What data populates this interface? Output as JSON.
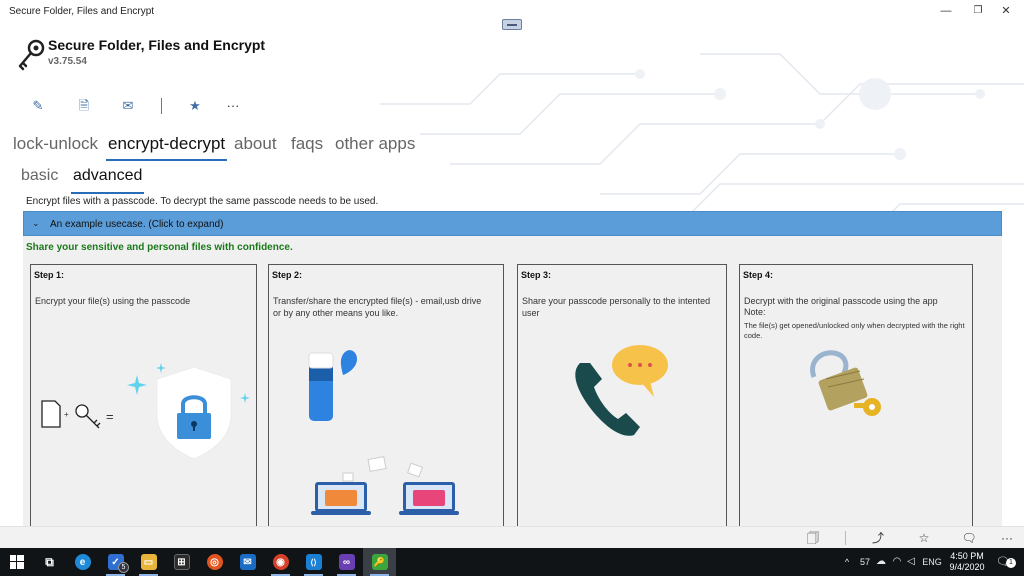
{
  "window": {
    "title": "Secure Folder, Files and Encrypt",
    "controls": {
      "minimize": "—",
      "restore": "❐",
      "close": "✕"
    }
  },
  "header": {
    "app_name": "Secure Folder, Files and Encrypt",
    "version": "v3.75.54",
    "logo_icon": "key-lock-icon"
  },
  "toolbar": {
    "items": [
      {
        "icon": "pencil-icon",
        "glyph": "✎"
      },
      {
        "icon": "document-lock-icon",
        "glyph": "🗎"
      },
      {
        "icon": "mail-icon",
        "glyph": "✉"
      },
      {
        "icon": "star-icon",
        "glyph": "★"
      },
      {
        "icon": "more-icon",
        "glyph": "···"
      }
    ]
  },
  "tabs": [
    {
      "label": "lock-unlock",
      "active": false
    },
    {
      "label": "encrypt-decrypt",
      "active": true
    },
    {
      "label": "about",
      "active": false
    },
    {
      "label": "faqs",
      "active": false
    },
    {
      "label": "other apps",
      "active": false
    }
  ],
  "subtabs": [
    {
      "label": "basic",
      "active": false
    },
    {
      "label": "advanced",
      "active": true
    }
  ],
  "description": "Encrypt files with a passcode. To decrypt the same passcode needs to be used.",
  "expander": {
    "chevron": "⌄",
    "label": "An example usecase. (Click to expand)"
  },
  "tagline": "Share your sensitive and personal files with confidence.",
  "steps": [
    {
      "title": "Step 1:",
      "text": "Encrypt your file(s) using the passcode"
    },
    {
      "title": "Step 2:",
      "text": "Transfer/share the encrypted file(s) - email,usb drive",
      "text2": "or by any other means you like."
    },
    {
      "title": "Step 3:",
      "text": "Share your passcode personally to the intented user"
    },
    {
      "title": "Step 4:",
      "text": "Decrypt with the original passcode using the app",
      "note": "Note:",
      "note_text": "The file(s) get opened/unlocked only when decrypted with the right code."
    }
  ],
  "step1_equation": "=",
  "command_bar": {
    "items": [
      {
        "icon": "clipboard-lock-icon",
        "glyph": "🗍"
      },
      {
        "icon": "share-icon",
        "glyph": "⤴"
      },
      {
        "icon": "favorite-icon",
        "glyph": "☆"
      },
      {
        "icon": "feedback-icon",
        "glyph": "🗨"
      },
      {
        "icon": "more-icon",
        "glyph": "···"
      }
    ]
  },
  "taskbar": {
    "apps": [
      {
        "icon": "task-view-icon",
        "glyph": "⧉",
        "color": "#111417"
      },
      {
        "icon": "edge-icon",
        "glyph": "e",
        "color": "#1f8bd8"
      },
      {
        "icon": "todo-icon",
        "glyph": "✓",
        "color": "#2f6fd1"
      },
      {
        "icon": "file-explorer-icon",
        "glyph": "▭",
        "color": "#e8b43a"
      },
      {
        "icon": "store-icon",
        "glyph": "⊞",
        "color": "#2b2b2b"
      },
      {
        "icon": "ubuntu-icon",
        "glyph": "◎",
        "color": "#e0551f"
      },
      {
        "icon": "mail-app-icon",
        "glyph": "✉",
        "color": "#1a6cc4"
      },
      {
        "icon": "chrome-icon",
        "glyph": "◉",
        "color": "#d6402b"
      },
      {
        "icon": "vscode-icon",
        "glyph": "⟨⟩",
        "color": "#1b7fd4"
      },
      {
        "icon": "visual-studio-icon",
        "glyph": "∞",
        "color": "#6a3fb4"
      },
      {
        "icon": "secure-folder-app-icon",
        "glyph": "🔑",
        "color": "#3da53d"
      }
    ],
    "todo_badge": "5",
    "tray": {
      "chevron": "^",
      "temperature": "57",
      "language": "ENG",
      "time": "4:50 PM",
      "date": "9/4/2020",
      "notifications_badge": "1"
    }
  }
}
